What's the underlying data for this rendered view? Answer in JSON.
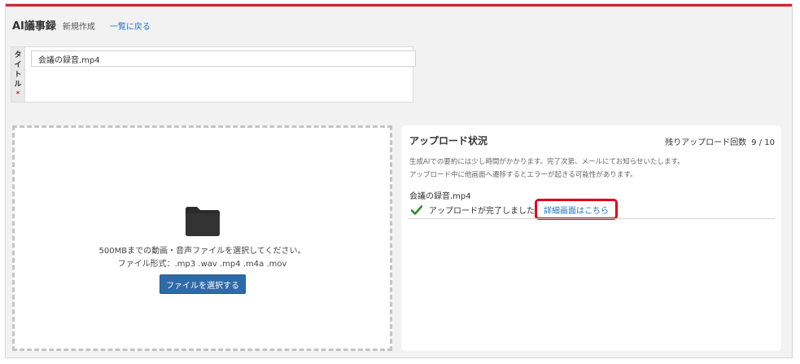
{
  "header": {
    "app_title": "AI議事録",
    "subtitle": "新規作成",
    "back_link": "一覧に戻る",
    "accent_color": "#d0262d"
  },
  "title_field": {
    "label_chars": [
      "タ",
      "イ",
      "ト",
      "ル"
    ],
    "required_mark": "*",
    "value": "会議の録音.mp4"
  },
  "dropzone": {
    "icon": "folder-icon",
    "instruction": "500MBまでの動画・音声ファイルを選択してください。",
    "formats": "ファイル形式：.mp3 .wav .mp4 .m4a .mov",
    "select_button": "ファイルを選択する"
  },
  "upload_status": {
    "title": "アップロード状況",
    "remaining_label": "残りアップロード回数",
    "remaining_count": "9 / 10",
    "notice_line1": "生成AIでの要約には少し時間がかかります。完了次第、メールにてお知らせいたします。",
    "notice_line2": "アップロード中に他画面へ遷移するとエラーが起きる可能性があります。",
    "file_name": "会議の録音.mp4",
    "status_icon": "check-icon",
    "status_text": "アップロードが完了しました",
    "detail_link": "詳細画面はこちら",
    "success_color": "#2e8b2e",
    "highlight_color": "#e0001b"
  }
}
